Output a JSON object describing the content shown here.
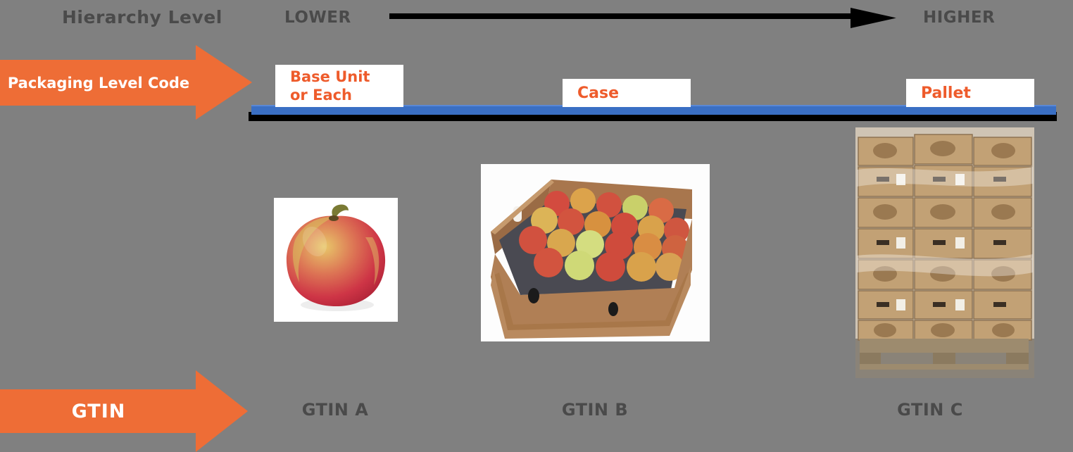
{
  "diagram": {
    "background_color": "#808080",
    "accent_orange": "#ee6d36",
    "rail_blue": "#3a6fc4",
    "label_orange": "#ee5b2b",
    "text_gray": "#4a4a4a"
  },
  "hierarchy_row": {
    "row_title": "Hierarchy Level",
    "low_end": "LOWER",
    "high_end": "HIGHER",
    "arrow_icon": "right-arrow-icon"
  },
  "packaging_row": {
    "arrow_label": "Packaging Level Code",
    "levels": [
      {
        "id": "each",
        "label": "Base Unit\nor Each",
        "line1": "Base Unit",
        "line2": "or Each"
      },
      {
        "id": "case",
        "label": "Case"
      },
      {
        "id": "pallet",
        "label": "Pallet"
      }
    ]
  },
  "photos": [
    {
      "id": "each",
      "alt": "single-apple-photo"
    },
    {
      "id": "case",
      "alt": "case-of-apples-photo"
    },
    {
      "id": "pallet",
      "alt": "pallet-of-boxes-photo"
    }
  ],
  "gtin_row": {
    "arrow_label": "GTIN",
    "captions": [
      {
        "id": "a",
        "label": "GTIN A"
      },
      {
        "id": "b",
        "label": "GTIN B"
      },
      {
        "id": "c",
        "label": "GTIN C"
      }
    ]
  }
}
